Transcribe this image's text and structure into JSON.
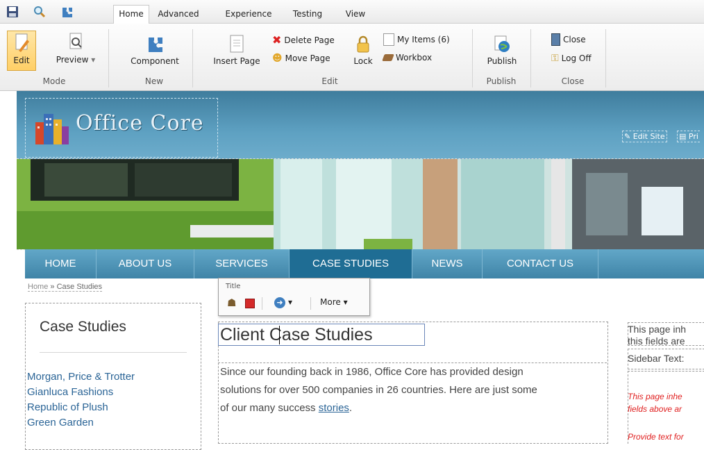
{
  "ribbon": {
    "tabs": [
      "Home",
      "Advanced",
      "Experience",
      "Testing",
      "View"
    ],
    "active_tab": "Home",
    "groups": {
      "mode": {
        "label": "Mode",
        "edit": "Edit",
        "preview": "Preview"
      },
      "new": {
        "label": "New",
        "component": "Component"
      },
      "edit": {
        "label": "Edit",
        "insert_page": "Insert Page",
        "delete_page": "Delete Page",
        "move_page": "Move Page",
        "lock": "Lock",
        "my_items": "My Items (6)",
        "workbox": "Workbox"
      },
      "publish": {
        "label": "Publish",
        "publish": "Publish"
      },
      "close": {
        "label": "Close",
        "close": "Close",
        "log_off": "Log Off"
      }
    }
  },
  "site": {
    "logo_text": "Office Core",
    "header_links": {
      "edit_site": "Edit Site",
      "print": "Pri"
    },
    "nav": [
      "HOME",
      "ABOUT US",
      "SERVICES",
      "CASE STUDIES",
      "NEWS",
      "CONTACT US"
    ],
    "nav_active": "CASE STUDIES",
    "breadcrumb": {
      "home": "Home",
      "sep": "»",
      "current": "Case Studies"
    },
    "field_toolbar": {
      "title": "Title",
      "more": "More"
    },
    "sidebar": {
      "heading": "Case Studies",
      "links": [
        "Morgan, Price & Trotter",
        "Gianluca Fashions",
        "Republic of Plush",
        "Green Garden"
      ]
    },
    "main": {
      "title_part1": "Client",
      "title_part2": "Case Studies",
      "body_line1": "Since our founding back in 1986, Office Core has provided design",
      "body_line2": "solutions for over 500 companies in 26 countries. Here are just some",
      "body_line3": "of our many success ",
      "body_link": "stories",
      "body_end": "."
    },
    "right_column": {
      "line1": "This page inh",
      "line2": "this fields are",
      "line3": "Sidebar Text:",
      "red1": "This page inhe",
      "red2": "fields above ar",
      "red3": "Provide text for"
    }
  },
  "colors": {
    "header_blue": "#5ea1c2",
    "nav_active": "#1f6d94",
    "link_blue": "#2a6496",
    "warning_red": "#e02020"
  }
}
